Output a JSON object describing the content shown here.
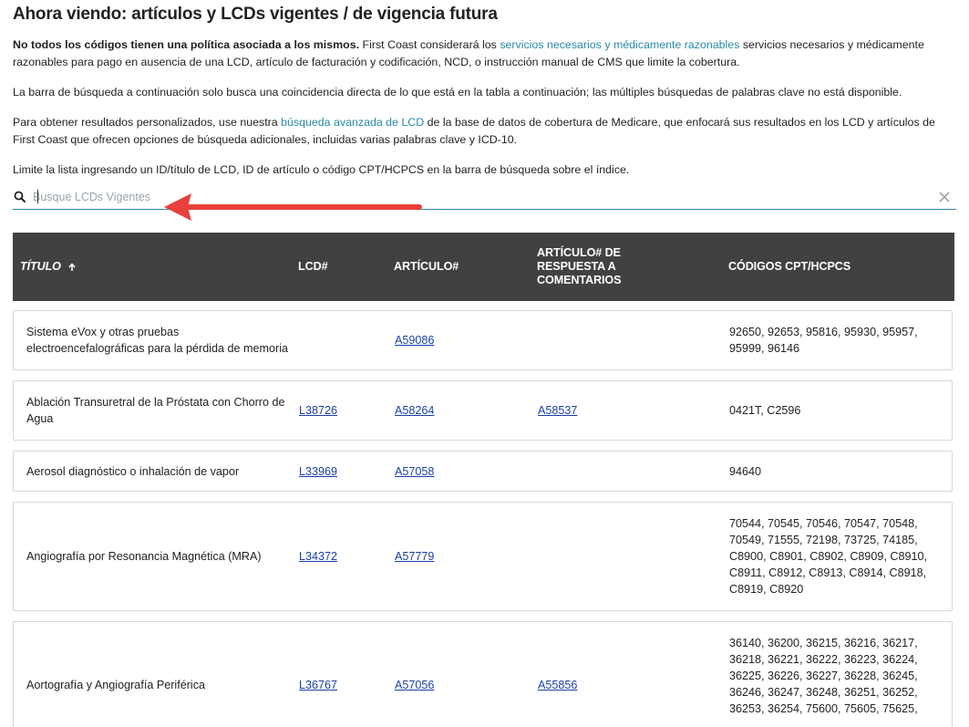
{
  "page": {
    "title": "Ahora viendo: artículos y LCDs vigentes / de vigencia futura"
  },
  "intro": {
    "p1_bold": "No todos los códigos tienen una política asociada a los mismos.",
    "p1_text_a": " First Coast considerará los ",
    "p1_link": "servicios necesarios y médicamente razonables",
    "p1_text_b": " servicios necesarios y médicamente razonables para pago en ausencia de una LCD, artículo de facturación y codificación, NCD, o instrucción manual de CMS que limite la cobertura.",
    "p2": "La barra de búsqueda a continuación solo busca una coincidencia directa de lo que está en la tabla a continuación; las múltiples búsquedas de palabras clave no está disponible.",
    "p3_text_a": "Para obtener resultados personalizados, use nuestra ",
    "p3_link": "búsqueda avanzada de LCD",
    "p3_text_b": " de la base de datos de cobertura de Medicare, que enfocará sus resultados en los LCD y artículos de First Coast que ofrecen opciones de búsqueda adicionales, incluidas varias palabras clave y ICD-10.",
    "p4": "Limite la lista ingresando un ID/título de LCD, ID de artículo o código CPT/HCPCS en la barra de búsqueda sobre el índice."
  },
  "search": {
    "placeholder": "Busque LCDs Vigentes",
    "value": ""
  },
  "table": {
    "headers": {
      "title": "TÍTULO",
      "lcd": "LCD#",
      "article": "ARTÍCULO#",
      "response_line1": "ARTÍCULO# DE",
      "response_line2": "RESPUESTA A",
      "response_line3": "COMENTARIOS",
      "cpt": "CÓDIGOS CPT/HCPCS"
    },
    "rows": [
      {
        "title": "Sistema eVox y otras pruebas electroencefalográficas para la pérdida de memoria",
        "lcd": "",
        "article": "A59086",
        "response": "",
        "cpt": "92650, 92653, 95816, 95930, 95957, 95999, 96146"
      },
      {
        "title": "Ablación Transuretral de la Próstata con Chorro de Agua",
        "lcd": "L38726",
        "article": "A58264",
        "response": "A58537",
        "cpt": "0421T, C2596"
      },
      {
        "title": "Aerosol diagnóstico o inhalación de vapor",
        "lcd": "L33969",
        "article": "A57058",
        "response": "",
        "cpt": "94640"
      },
      {
        "title": "Angiografía por Resonancia Magnética (MRA)",
        "lcd": "L34372",
        "article": "A57779",
        "response": "",
        "cpt": "70544, 70545, 70546, 70547, 70548, 70549, 71555, 72198, 73725, 74185, C8900, C8901, C8902, C8909, C8910, C8911, C8912, C8913, C8914, C8918, C8919, C8920"
      },
      {
        "title": "Aortografía y Angiografía Periférica",
        "lcd": "L36767",
        "article": "A57056",
        "response": "A55856",
        "cpt": "36140, 36200, 36215, 36216, 36217, 36218, 36221, 36222, 36223, 36224, 36225, 36226, 36227, 36228, 36245, 36246, 36247, 36248, 36251, 36252, 36253, 36254, 75600, 75605, 75625,"
      }
    ]
  },
  "colors": {
    "header_bg": "#414141",
    "link_teal": "#2a8aa6",
    "link_blue": "#1a3fa8",
    "arrow_red": "#e8413b"
  }
}
